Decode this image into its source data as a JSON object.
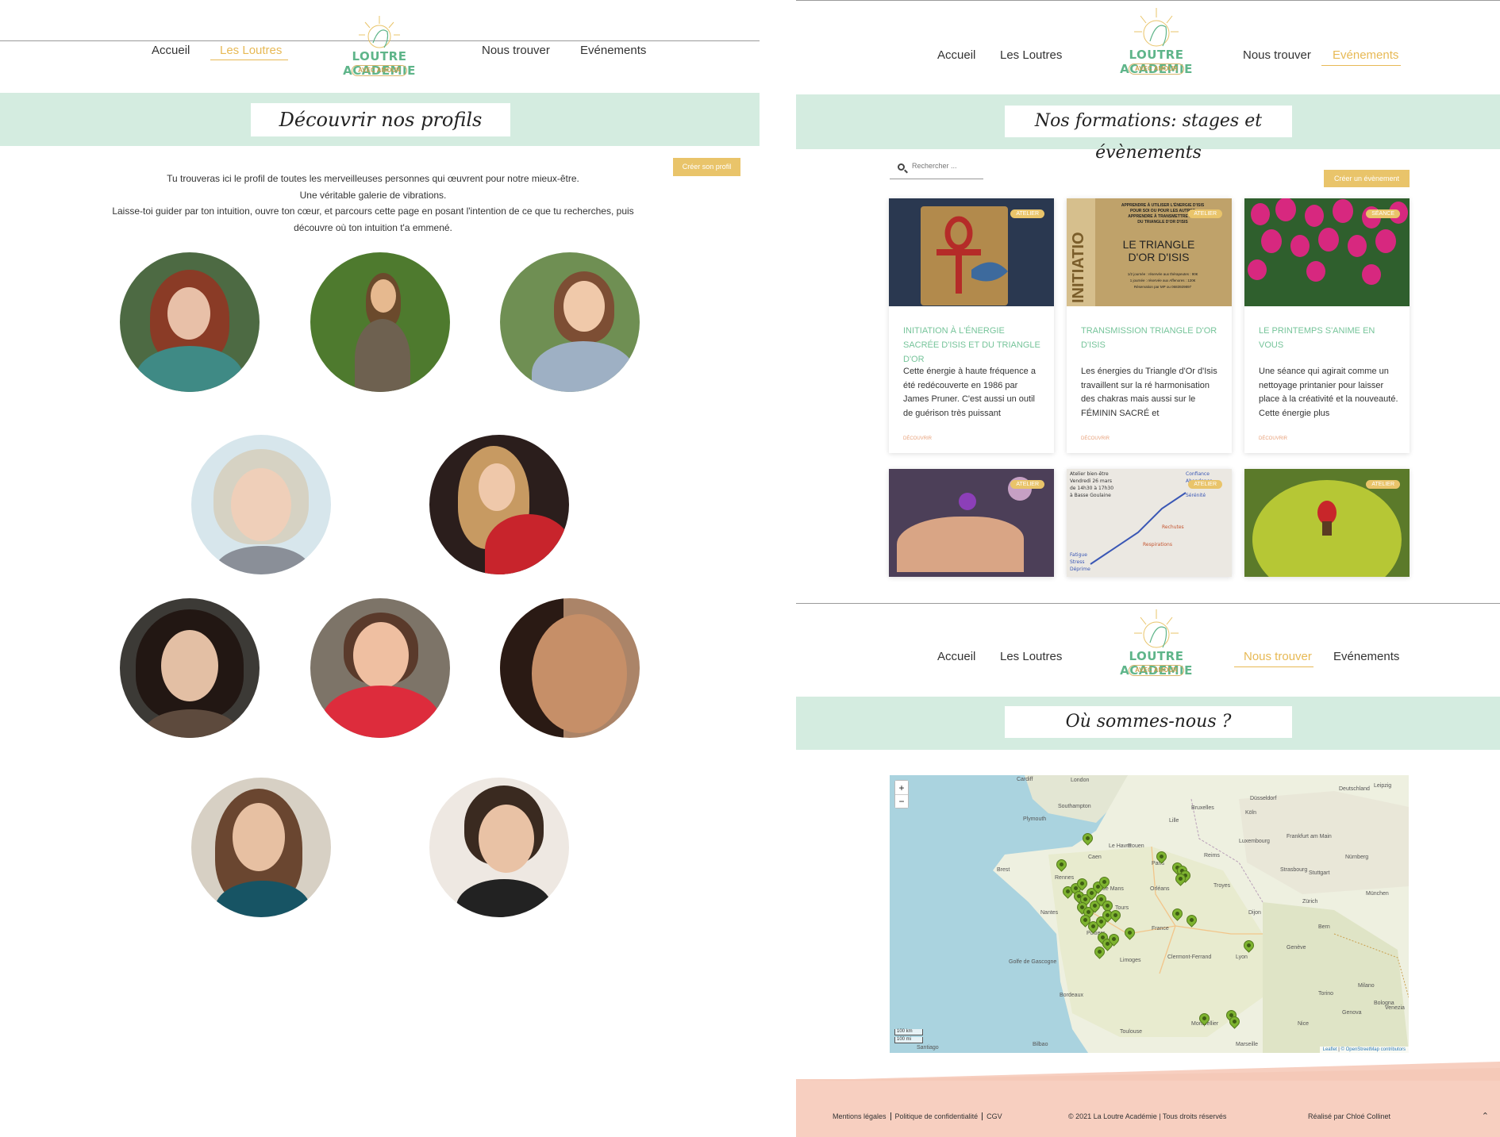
{
  "nav": {
    "home": "Accueil",
    "otters": "Les Loutres",
    "find_us": "Nous trouver",
    "events": "Evénements"
  },
  "logo": {
    "name": "LOUTRE ACADEMIE",
    "tagline": "AVEC AMOUR"
  },
  "profiles_page": {
    "title": "Découvrir nos profils",
    "create_button": "Créer son profil",
    "intro_lines": [
      "Tu trouveras ici le profil de toutes les merveilleuses personnes qui œuvrent pour notre mieux-être.",
      "Une véritable galerie de vibrations.",
      "Laisse-toi guider par ton intuition, ouvre ton cœur, et parcours cette page en posant l'intention de ce que tu recherches, puis",
      "découvre où ton intuition t'a emmené."
    ]
  },
  "events_page": {
    "title": "Nos formations: stages et évènements",
    "search_placeholder": "Rechercher ...",
    "create_button": "Créer un évènement",
    "cards": [
      {
        "badge": "ATELIER",
        "title": "INITIATION À L'ÉNERGIE SACRÉE D'ISIS ET DU TRIANGLE D'OR",
        "text": "Cette énergie à haute fréquence a été redécouverte en 1986 par James Pruner. C'est aussi un outil de guérison très puissant",
        "link": "DÉCOUVRIR"
      },
      {
        "badge": "ATELIER",
        "title": "TRANSMISSION TRIANGLE D'OR D'ISIS",
        "text": "Les énergies du Triangle d'Or d'Isis travaillent sur la ré harmonisation des chakras mais aussi sur le FÉMININ SACRÉ et",
        "link": "DÉCOUVRIR",
        "poster": {
          "side": "INITIATIO",
          "top_lines": [
            "APPRENDRE À UTILISER L'ÉNERGIE D'ISIS",
            "POUR SOI OU POUR LES AUTRES",
            "APPRENDRE À TRANSMETTRE LE...",
            "DU TRIANGLE D'OR D'ISIS"
          ],
          "headline": "LE TRIANGLE D'OR D'ISIS",
          "bottom_lines": [
            "1/2 journée : réservée aux thérapeutes : 90€",
            "1 journée : réservée aux Affenores : 120€",
            "Réservation par MP ou 0683929897"
          ]
        }
      },
      {
        "badge": "SÉANCE",
        "title": "LE PRINTEMPS S'ANIME EN VOUS",
        "text": "Une séance qui agirait comme un nettoyage printanier pour laisser place à la créativité et la nouveauté. Cette énergie plus",
        "link": "DÉCOUVRIR"
      },
      {
        "badge": "ATELIER",
        "title": "",
        "text": "",
        "link": ""
      },
      {
        "badge": "ATELIER",
        "title": "",
        "text": "",
        "link": "",
        "whiteboard": [
          "Atelier bien-être",
          "Vendredi 26 mars",
          "de 14h30 à 17h30",
          "à Basse Goulaine",
          "Confiance",
          "Abondance",
          "Sérénité",
          "Fatigue",
          "Stress",
          "Déprime",
          "Rechutes",
          "Respirations"
        ]
      },
      {
        "badge": "ATELIER",
        "title": "",
        "text": "",
        "link": ""
      }
    ]
  },
  "map_page": {
    "title": "Où sommes-nous ?",
    "zoom_in": "+",
    "zoom_out": "−",
    "scale_km": "100 km",
    "scale_mi": "100 mi",
    "attribution_leaflet": "Leaflet",
    "attribution_osm": "© OpenStreetMap contributors",
    "cities": [
      "London",
      "Cardiff",
      "Plymouth",
      "Southampton",
      "Bruxelles",
      "Lille",
      "Rouen",
      "Le Havre",
      "Paris",
      "Caen",
      "Rennes",
      "Brest",
      "Le Mans",
      "Nantes",
      "Tours",
      "Orléans",
      "Reims",
      "Troyes",
      "Dijon",
      "Poitiers",
      "Limoges",
      "Bordeaux",
      "Toulouse",
      "Montpellier",
      "Marseille",
      "Lyon",
      "Genève",
      "Bern",
      "Milano",
      "Torino",
      "Frankfurt am Main",
      "Nürnberg",
      "Stuttgart",
      "München",
      "Zürich",
      "Düsseldorf",
      "Köln",
      "Luxembourg",
      "Strasbourg",
      "Golfe de Gascogne",
      "Bilbao",
      "Santiago",
      "Deutschland",
      "France",
      "Clermont-Ferrand",
      "Bologna",
      "Genova",
      "Nice",
      "Leipzig",
      "Venezia"
    ]
  },
  "footer": {
    "legal": "Mentions légales",
    "privacy": "Politique de confidentialité",
    "cgv": "CGV",
    "copyright": "© 2021 La Loutre Académie | Tous droits réservés",
    "credit": "Réalisé par Chloé Collinet",
    "top": "⌃"
  },
  "colors": {
    "mint": "#d4ece0",
    "gold": "#e9c46a",
    "green": "#76c49a",
    "peach": "#f7cfc0"
  }
}
